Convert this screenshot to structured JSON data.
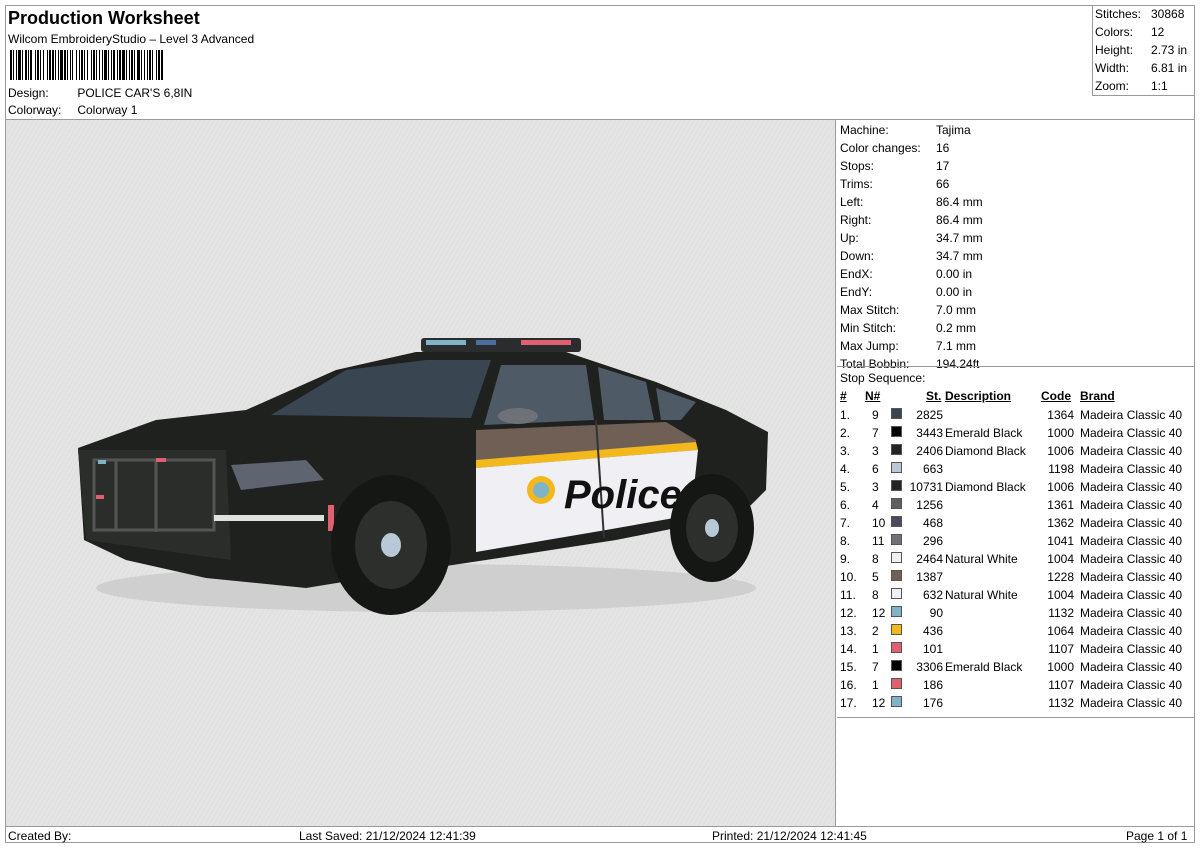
{
  "header": {
    "title": "Production Worksheet",
    "software": "Wilcom EmbroideryStudio – Level 3 Advanced",
    "design_label": "Design:",
    "design_value": "POLICE CAR'S 6,8IN",
    "colorway_label": "Colorway:",
    "colorway_value": "Colorway 1"
  },
  "summary": {
    "stitches_label": "Stitches:",
    "stitches_value": "30868",
    "colors_label": "Colors:",
    "colors_value": "12",
    "height_label": "Height:",
    "height_value": "2.73 in",
    "width_label": "Width:",
    "width_value": "6.81 in",
    "zoom_label": "Zoom:",
    "zoom_value": "1:1"
  },
  "machine": [
    {
      "label": "Machine:",
      "value": "Tajima"
    },
    {
      "label": "Color changes:",
      "value": "16"
    },
    {
      "label": "Stops:",
      "value": "17"
    },
    {
      "label": "Trims:",
      "value": "66"
    },
    {
      "label": "Left:",
      "value": "86.4 mm"
    },
    {
      "label": "Right:",
      "value": "86.4 mm"
    },
    {
      "label": "Up:",
      "value": "34.7 mm"
    },
    {
      "label": "Down:",
      "value": "34.7 mm"
    },
    {
      "label": "EndX:",
      "value": "0.00 in"
    },
    {
      "label": "EndY:",
      "value": "0.00 in"
    },
    {
      "label": "Max Stitch:",
      "value": "7.0 mm"
    },
    {
      "label": "Min Stitch:",
      "value": "0.2 mm"
    },
    {
      "label": "Max Jump:",
      "value": "7.1 mm"
    },
    {
      "label": "Total Bobbin:",
      "value": "194.24ft"
    }
  ],
  "stop_sequence": {
    "title": "Stop Sequence:",
    "columns": [
      "#",
      "N#",
      "St.",
      "Description",
      "Code",
      "Brand"
    ],
    "rows": [
      {
        "idx": "1.",
        "n": "9",
        "color": "#3d4552",
        "st": "2825",
        "desc": "",
        "code": "1364",
        "brand": "Madeira Classic 40"
      },
      {
        "idx": "2.",
        "n": "7",
        "color": "#000000",
        "st": "3443",
        "desc": "Emerald Black",
        "code": "1000",
        "brand": "Madeira Classic 40"
      },
      {
        "idx": "3.",
        "n": "3",
        "color": "#232323",
        "st": "2406",
        "desc": "Diamond Black",
        "code": "1006",
        "brand": "Madeira Classic 40"
      },
      {
        "idx": "4.",
        "n": "6",
        "color": "#b8c8d6",
        "st": "663",
        "desc": "",
        "code": "1198",
        "brand": "Madeira Classic 40"
      },
      {
        "idx": "5.",
        "n": "3",
        "color": "#232323",
        "st": "10731",
        "desc": "Diamond Black",
        "code": "1006",
        "brand": "Madeira Classic 40"
      },
      {
        "idx": "6.",
        "n": "4",
        "color": "#5f5f5f",
        "st": "1256",
        "desc": "",
        "code": "1361",
        "brand": "Madeira Classic 40"
      },
      {
        "idx": "7.",
        "n": "10",
        "color": "#4a4a5a",
        "st": "468",
        "desc": "",
        "code": "1362",
        "brand": "Madeira Classic 40"
      },
      {
        "idx": "8.",
        "n": "11",
        "color": "#6e7278",
        "st": "296",
        "desc": "",
        "code": "1041",
        "brand": "Madeira Classic 40"
      },
      {
        "idx": "9.",
        "n": "8",
        "color": "#f0f0f4",
        "st": "2464",
        "desc": "Natural White",
        "code": "1004",
        "brand": "Madeira Classic 40"
      },
      {
        "idx": "10.",
        "n": "5",
        "color": "#6f5f55",
        "st": "1387",
        "desc": "",
        "code": "1228",
        "brand": "Madeira Classic 40"
      },
      {
        "idx": "11.",
        "n": "8",
        "color": "#f0f0f4",
        "st": "632",
        "desc": "Natural White",
        "code": "1004",
        "brand": "Madeira Classic 40"
      },
      {
        "idx": "12.",
        "n": "12",
        "color": "#7fb4c8",
        "st": "90",
        "desc": "",
        "code": "1132",
        "brand": "Madeira Classic 40"
      },
      {
        "idx": "13.",
        "n": "2",
        "color": "#f2b81c",
        "st": "436",
        "desc": "",
        "code": "1064",
        "brand": "Madeira Classic 40"
      },
      {
        "idx": "14.",
        "n": "1",
        "color": "#e06070",
        "st": "101",
        "desc": "",
        "code": "1107",
        "brand": "Madeira Classic 40"
      },
      {
        "idx": "15.",
        "n": "7",
        "color": "#000000",
        "st": "3306",
        "desc": "Emerald Black",
        "code": "1000",
        "brand": "Madeira Classic 40"
      },
      {
        "idx": "16.",
        "n": "1",
        "color": "#e06070",
        "st": "186",
        "desc": "",
        "code": "1107",
        "brand": "Madeira Classic 40"
      },
      {
        "idx": "17.",
        "n": "12",
        "color": "#7fb4c8",
        "st": "176",
        "desc": "",
        "code": "1132",
        "brand": "Madeira Classic 40"
      }
    ]
  },
  "preview": {
    "door_text": "Police"
  },
  "footer": {
    "created_by": "Created By:",
    "last_saved": "Last Saved: 21/12/2024 12:41:39",
    "printed": "Printed: 21/12/2024 12:41:45",
    "page": "Page 1 of 1"
  }
}
